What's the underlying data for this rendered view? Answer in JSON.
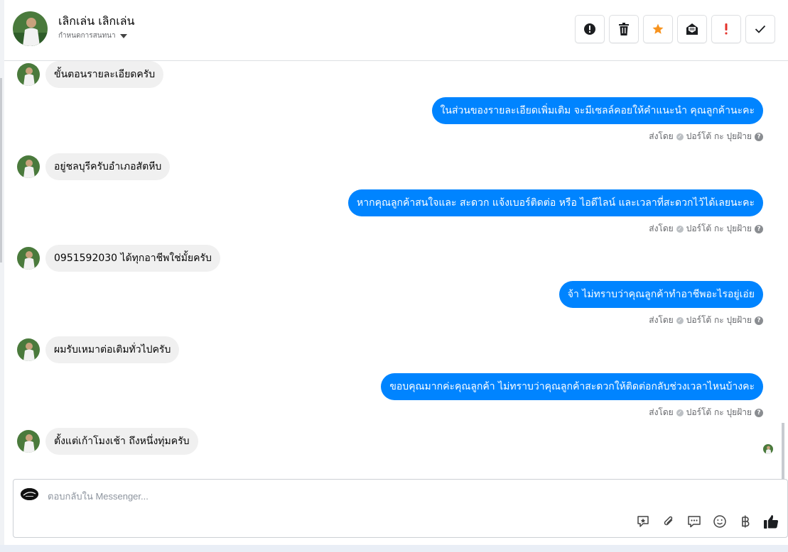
{
  "header": {
    "contact_name": "เลิกเล่น เลิกเล่น",
    "subtitle": "กำหนดการสนทนา",
    "tools": [
      "alert-icon",
      "trash-icon",
      "star-icon",
      "mail-icon",
      "exclamation-icon",
      "check-icon"
    ]
  },
  "messages": [
    {
      "dir": "in",
      "text": "ขั้นตอนรายละเอียดครับ"
    },
    {
      "dir": "out",
      "text": "ในส่วนของรายละเอียดเพิ่มเติม จะมีเซลล์คอยให้คำแนะนำ คุณลูกค้านะคะ",
      "sent_label": "ส่งโดย",
      "sender": "ปอร์โต้ กะ ปุยฝ้าย"
    },
    {
      "dir": "in",
      "text": "อยู่ชลบุรีครับอำเภอสัตหีบ"
    },
    {
      "dir": "out",
      "text": "หากคุณลูกค้าสนใจและ สะดวก แจ้งเบอร์ติดต่อ หรือ ไอดีไลน์ และเวลาที่สะดวกไว้ได้เลยนะคะ",
      "sent_label": "ส่งโดย",
      "sender": "ปอร์โต้ กะ ปุยฝ้าย"
    },
    {
      "dir": "in",
      "text": "0951592030 ได้ทุกอาชีพใช่มั้ยครับ"
    },
    {
      "dir": "out",
      "text": "จ้า ไม่ทราบว่าคุณลูกค้าทำอาชีพอะไรอยู่เอ่ย",
      "sent_label": "ส่งโดย",
      "sender": "ปอร์โต้ กะ ปุยฝ้าย"
    },
    {
      "dir": "in",
      "text": "ผมรับเหมาต่อเติมทั่วไปครับ"
    },
    {
      "dir": "out",
      "text": "ขอบคุณมากค่ะคุณลูกค้า ไม่ทราบว่าคุณลูกค้าสะดวกให้ติดต่อกลับช่วงเวลาไหนบ้างคะ",
      "sent_label": "ส่งโดย",
      "sender": "ปอร์โต้ กะ ปุยฝ้าย"
    },
    {
      "dir": "in",
      "text": "ตั้งแต่เก้าโมงเช้า ถึงหนึ่งทุ่มครับ"
    }
  ],
  "composer": {
    "placeholder": "ตอบกลับใน Messenger...",
    "icons": [
      "sticker-icon",
      "attachment-icon",
      "saved-reply-icon",
      "emoji-icon",
      "baht-icon",
      "like-icon"
    ]
  },
  "colors": {
    "accent": "#0084ff",
    "incoming_bubble": "#f0f0f0",
    "star": "#f7931e",
    "alert_red": "#e4322b"
  }
}
